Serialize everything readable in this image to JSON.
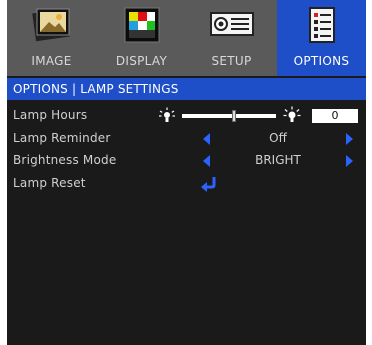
{
  "tabs": [
    {
      "label": "IMAGE",
      "icon": "image-icon",
      "active": false
    },
    {
      "label": "DISPLAY",
      "icon": "display-icon",
      "active": false
    },
    {
      "label": "SETUP",
      "icon": "setup-icon",
      "active": false
    },
    {
      "label": "OPTIONS",
      "icon": "options-icon",
      "active": true
    }
  ],
  "breadcrumb": "OPTIONS | LAMP SETTINGS",
  "items": [
    {
      "label": "Lamp Hours",
      "value": "0",
      "level": 0.55
    },
    {
      "label": "Lamp Reminder",
      "value": "Off"
    },
    {
      "label": "Brightness Mode",
      "value": "BRIGHT"
    },
    {
      "label": "Lamp Reset"
    }
  ],
  "colors": {
    "accent": "#1f4fc8",
    "arrow": "#2a63ff",
    "background": "#1a1a1a",
    "tabbar": "#5a5a5a"
  }
}
